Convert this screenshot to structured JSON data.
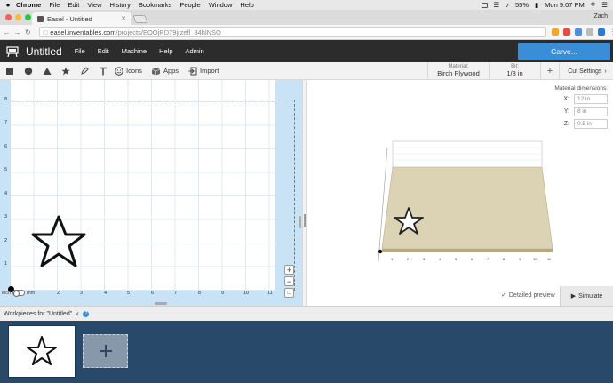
{
  "macos": {
    "app_name": "Chrome",
    "menus": [
      "File",
      "Edit",
      "View",
      "History",
      "Bookmarks",
      "People",
      "Window",
      "Help"
    ],
    "battery": "55%",
    "clock": "Mon 9:07 PM"
  },
  "browser": {
    "tab_title": "Easel - Untitled",
    "url_host": "easel.inventables.com",
    "url_path": "/projects/EOOjRD79jrzefl_84hlNSQ",
    "profile_name": "Zach"
  },
  "header": {
    "title": "Untitled",
    "menus": [
      "File",
      "Edit",
      "Machine",
      "Help",
      "Admin"
    ],
    "carve_label": "Carve..."
  },
  "tools": {
    "icons_label": "Icons",
    "apps_label": "Apps",
    "import_label": "Import"
  },
  "material": {
    "label": "Material:",
    "value": "Birch Plywood"
  },
  "bit": {
    "label": "Bit:",
    "value": "1/8 in"
  },
  "add_bit_label": "+",
  "cut_settings_label": "Cut Settings",
  "design": {
    "y_ticks": [
      "8",
      "7",
      "6",
      "5",
      "4",
      "3",
      "2",
      "1"
    ],
    "x_ticks": [
      "2",
      "3",
      "4",
      "5",
      "6",
      "7",
      "8",
      "9",
      "10",
      "11"
    ],
    "unit_left": "inch",
    "unit_right": "mm",
    "zoom_in": "+",
    "zoom_out": "−"
  },
  "material_dimensions": {
    "title": "Material dimensions:",
    "x_label": "X:",
    "x_value": "12 in",
    "y_label": "Y:",
    "y_value": "8 in",
    "z_label": "Z:",
    "z_value": "0.5 in"
  },
  "preview": {
    "detailed_label": "Detailed preview",
    "simulate_label": "Simulate",
    "x_ticks": [
      "1",
      "2",
      "3",
      "4",
      "5",
      "6",
      "7",
      "8",
      "9",
      "10",
      "11"
    ]
  },
  "workpieces": {
    "header": "Workpieces for \"Untitled\""
  },
  "colors": {
    "header_bg": "#2c2c2c",
    "carve_button": "#3a8ed8",
    "workpiece_bg": "#29496a",
    "canvas_margin": "#c7e3f5",
    "wood": "#dcd2b4"
  }
}
